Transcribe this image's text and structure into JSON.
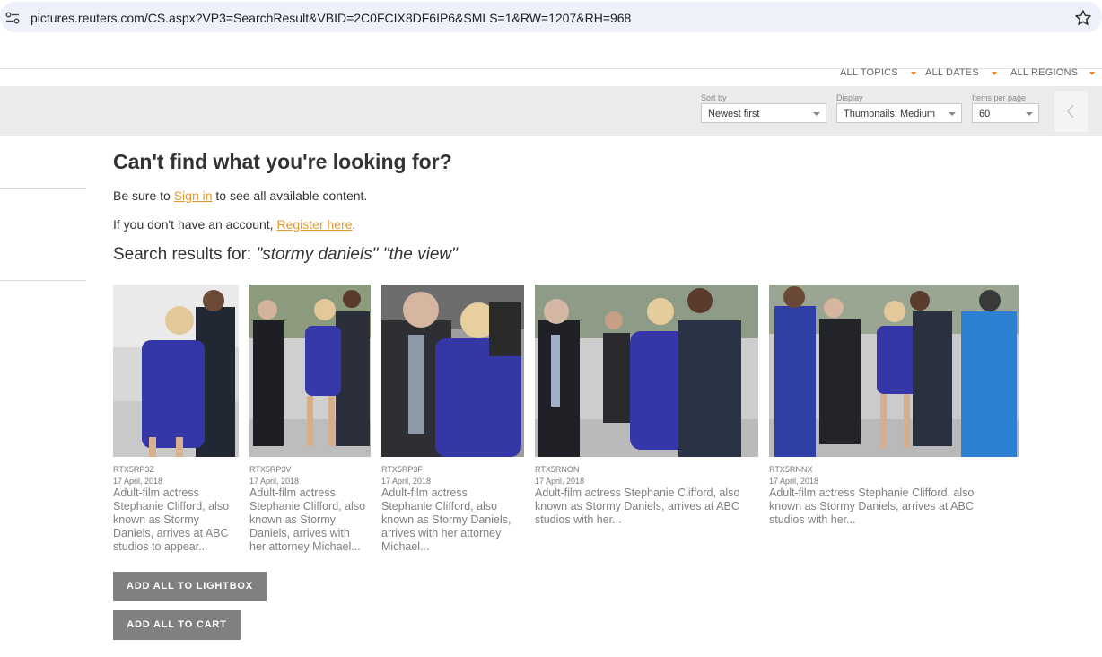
{
  "browser": {
    "url": "pictures.reuters.com/CS.aspx?VP3=SearchResult&VBID=2C0FCIX8DF6IP6&SMLS=1&RW=1207&RH=968"
  },
  "filters": {
    "topics": "ALL TOPICS",
    "dates": "ALL DATES",
    "regions": "ALL REGIONS"
  },
  "controls": {
    "sort_label": "Sort by",
    "sort_value": "Newest first",
    "display_label": "Display",
    "display_value": "Thumbnails: Medium",
    "items_label": "Items per page",
    "items_value": "60"
  },
  "notice": {
    "heading": "Can't find what you're looking for?",
    "signin_pre": "Be sure to ",
    "signin_link": "Sign in",
    "signin_post": " to see all available content.",
    "register_pre": "If you don't have an account, ",
    "register_link": "Register here",
    "register_post": "."
  },
  "search": {
    "label": "Search results for: ",
    "query": "\"stormy daniels\" \"the view\""
  },
  "results": [
    {
      "id": "RTX5RP3Z",
      "date": "17 April, 2018",
      "caption": [
        "Adult-film actress",
        "Stephanie Clifford, also",
        "known as Stormy",
        "Daniels, arrives at ABC",
        "studios to appear..."
      ]
    },
    {
      "id": "RTX5RP3V",
      "date": "17 April, 2018",
      "caption": [
        "Adult-film actress",
        "Stephanie Clifford, also",
        "known as Stormy",
        "Daniels, arrives with",
        "her attorney Michael..."
      ]
    },
    {
      "id": "RTX5RP3F",
      "date": "17 April, 2018",
      "caption": [
        "Adult-film actress",
        "Stephanie Clifford, also",
        "known as Stormy Daniels,",
        "arrives with her attorney",
        "Michael..."
      ]
    },
    {
      "id": "RTX5RNON",
      "date": "17 April, 2018",
      "caption": [
        "Adult-film actress Stephanie Clifford, also",
        "known as Stormy Daniels, arrives at ABC",
        "studios with her..."
      ]
    },
    {
      "id": "RTX5RNNX",
      "date": "17 April, 2018",
      "caption": [
        "Adult-film actress Stephanie Clifford, also",
        "known as Stormy Daniels, arrives at ABC",
        "studios with her..."
      ]
    }
  ],
  "actions": {
    "add_lightbox": "ADD ALL TO LIGHTBOX",
    "add_cart": "ADD ALL TO CART"
  }
}
